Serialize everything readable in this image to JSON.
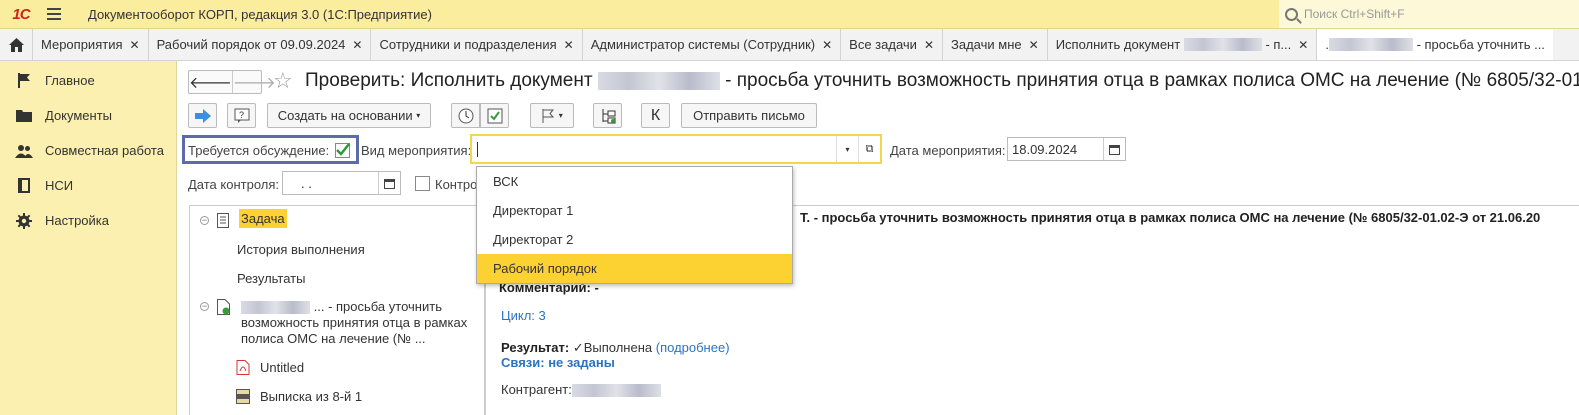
{
  "app": {
    "title": "Документооборот КОРП, редакция 3.0  (1С:Предприятие)",
    "logo_text": "1С",
    "search_placeholder": "Поиск Ctrl+Shift+F"
  },
  "tabs": [
    {
      "label": "Мероприятия"
    },
    {
      "label": "Рабочий порядок от 09.09.2024"
    },
    {
      "label": "Сотрудники и подразделения"
    },
    {
      "label": "Администратор системы (Сотрудник)"
    },
    {
      "label": "Все задачи"
    },
    {
      "label": "Задачи мне"
    },
    {
      "label": "Исполнить документ",
      "suffix": "- п..."
    },
    {
      "label": "",
      "prefix": ".",
      "suffix": "- просьба уточнить ..."
    }
  ],
  "sidebar": {
    "items": [
      {
        "label": "Главное",
        "icon": "flag-icon"
      },
      {
        "label": "Документы",
        "icon": "folder-icon"
      },
      {
        "label": "Совместная работа",
        "icon": "people-icon"
      },
      {
        "label": "НСИ",
        "icon": "book-icon"
      },
      {
        "label": "Настройка",
        "icon": "gear-icon"
      }
    ]
  },
  "form": {
    "title_prefix": "Проверить: Исполнить документ",
    "title_suffix": "- просьба уточнить возможность принятия отца в рамках полиса ОМС на лечение (№ 6805/32-01.",
    "toolbar": {
      "create_based_on": "Создать на основании",
      "send_letter": "Отправить письмо",
      "k_label": "К"
    },
    "discussion_label": "Требуется обсуждение:",
    "discussion_checked": true,
    "event_type_label": "Вид мероприятия:",
    "event_type_value": "",
    "event_date_label": "Дата мероприятия:",
    "event_date_value": "18.09.2024",
    "control_date_label": "Дата контроля:",
    "control_date_value": " .  .",
    "control_check_label": "Контро"
  },
  "dropdown": {
    "options": [
      "ВСК",
      "Директорат 1",
      "Директорат 2",
      "Рабочий порядок"
    ],
    "selected_index": 3
  },
  "tree": {
    "task_label": "Задача",
    "history_label": "История выполнения",
    "results_label": "Результаты",
    "doc_line1_suffix": "... - просьба уточнить",
    "doc_line2": "возможность принятия отца в рамках",
    "doc_line3": "полиса ОМС на лечение (№ ...",
    "file1": "Untitled",
    "file2": "Выписка из 8-й 1"
  },
  "detail": {
    "header_text": "Т. - просьба уточнить возможность принятия отца в рамках полиса ОМС на лечение (№ 6805/32-01.02-Э от 21.06.20",
    "comment_label": "Комментарий:",
    "comment_value": "-",
    "cycle_label": "Цикл: 3",
    "result_label": "Результат:",
    "result_value": "Выполнена",
    "result_link": "(подробнее)",
    "links_label": "Связи: не заданы",
    "counterparty_label": "Контрагент:"
  }
}
